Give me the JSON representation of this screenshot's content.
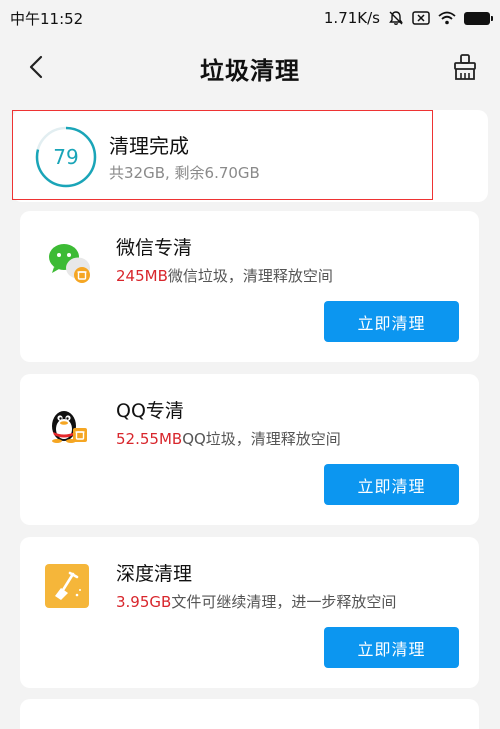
{
  "status_bar": {
    "time": "中午11:52",
    "speed": "1.71K/s"
  },
  "header": {
    "title": "垃圾清理"
  },
  "summary": {
    "score": "79",
    "title": "清理完成",
    "subtitle": "共32GB, 剩余6.70GB"
  },
  "cards": [
    {
      "title": "微信专清",
      "amount": "245MB",
      "desc": "微信垃圾，清理释放空间",
      "button": "立即清理"
    },
    {
      "title": "QQ专清",
      "amount": "52.55MB",
      "desc": "QQ垃圾，清理释放空间",
      "button": "立即清理"
    },
    {
      "title": "深度清理",
      "amount": "3.95GB",
      "desc": "文件可继续清理，进一步释放空间",
      "button": "立即清理"
    }
  ],
  "colors": {
    "accent": "#0c96f0",
    "amount": "#d8262c",
    "ring": "#1aa5b8"
  }
}
